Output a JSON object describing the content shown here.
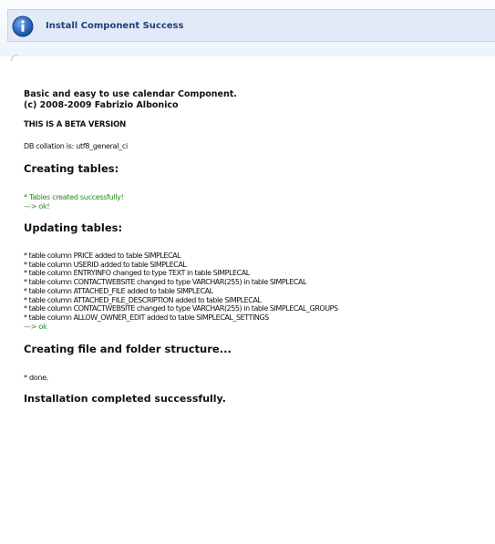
{
  "header": {
    "title": "Install Component Success",
    "icon": "info-icon",
    "accent_color": "#1a5fb4"
  },
  "intro": {
    "line1": "Basic and easy to use calendar Component.",
    "line2": "(c) 2008-2009 Fabrizio Albonico",
    "beta": "THIS IS A BETA VERSION",
    "collation": "DB collation is: utf8_general_ci"
  },
  "creating_tables": {
    "heading": "Creating tables:",
    "status": "* Tables created successfully!",
    "ok": "---> ok!"
  },
  "updating_tables": {
    "heading": "Updating tables:",
    "items": [
      "* table column PRICE added to table SIMPLECAL",
      "* table column USERID added to table SIMPLECAL",
      "* table column ENTRYINFO changed to type TEXT in table SIMPLECAL",
      "* table column CONTACTWEBSITE changed to type VARCHAR(255) in table SIMPLECAL",
      "* table column ATTACHED_FILE added to table SIMPLECAL",
      "* table column ATTACHED_FILE_DESCRIPTION added to table SIMPLECAL",
      "* table column CONTACTWEBSITE changed to type VARCHAR(255) in table SIMPLECAL_GROUPS",
      "* table column ALLOW_OWNER_EDIT added to table SIMPLECAL_SETTINGS"
    ],
    "ok": "---> ok"
  },
  "structure": {
    "heading": "Creating file and folder structure...",
    "done": "* done."
  },
  "final": {
    "message": "Installation completed successfully."
  },
  "colors": {
    "success_green": "#228b22",
    "header_bg": "#e2eaf7"
  }
}
